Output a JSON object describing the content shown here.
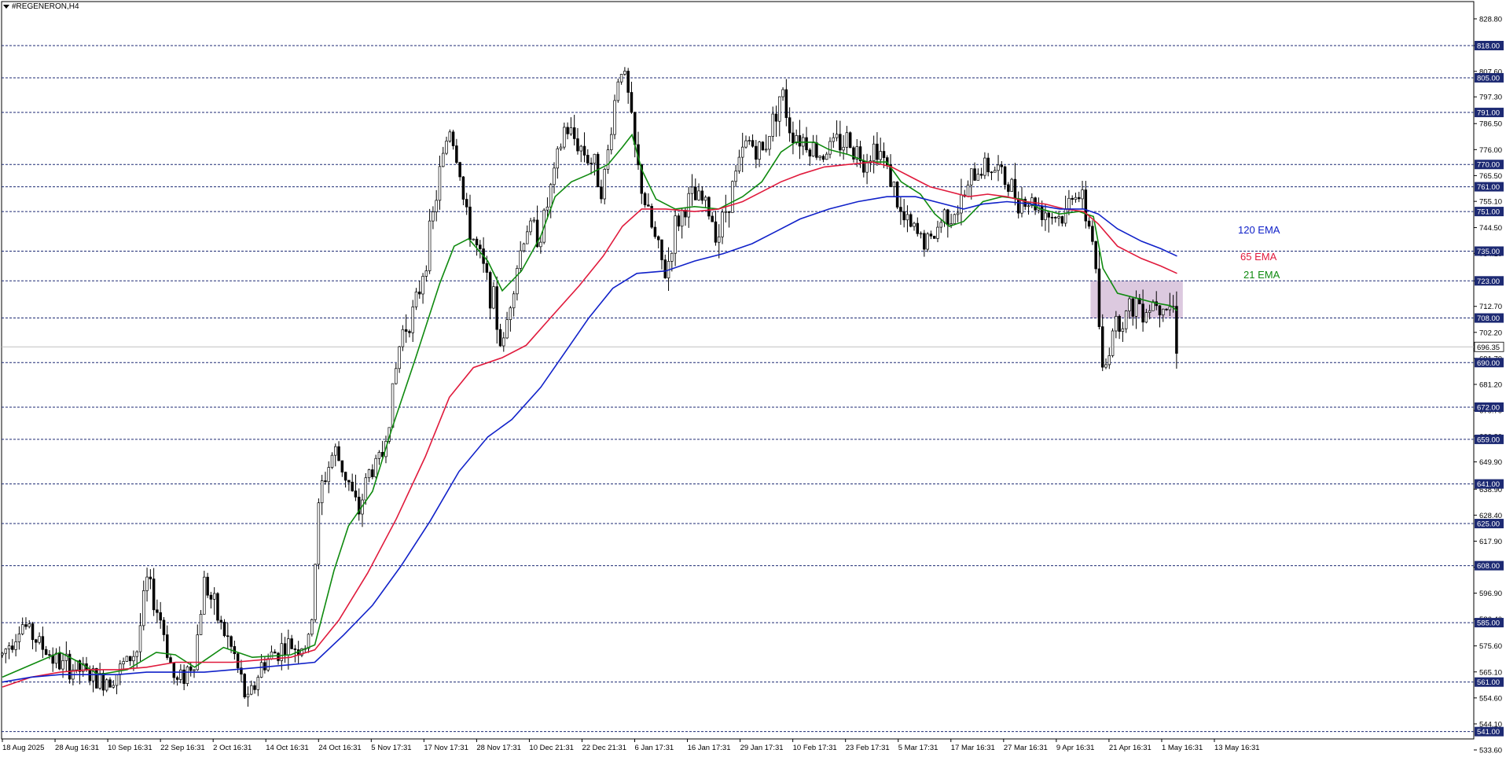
{
  "window": {
    "symbol_title": "#REGENERON,H4"
  },
  "chart_data": {
    "type": "candlestick",
    "symbol": "#REGENERON",
    "timeframe": "H4",
    "ylim": [
      533.6,
      832.6
    ],
    "price_ticks": [
      "828.80",
      "818.00",
      "807.60",
      "797.30",
      "786.50",
      "776.00",
      "765.50",
      "755.10",
      "744.50",
      "734.10",
      "723.00",
      "712.70",
      "702.20",
      "691.70",
      "681.20",
      "670.70",
      "660.30",
      "649.90",
      "638.90",
      "628.40",
      "617.90",
      "607.40",
      "596.90",
      "586.40",
      "575.60",
      "565.10",
      "554.60",
      "544.10",
      "533.60"
    ],
    "level_lines": [
      {
        "price": 818.0,
        "label": "818.00"
      },
      {
        "price": 805.0,
        "label": "805.00"
      },
      {
        "price": 791.0,
        "label": "791.00"
      },
      {
        "price": 770.0,
        "label": "770.00"
      },
      {
        "price": 761.0,
        "label": "761.00"
      },
      {
        "price": 751.0,
        "label": "751.00"
      },
      {
        "price": 735.0,
        "label": "735.00"
      },
      {
        "price": 723.0,
        "label": "723.00"
      },
      {
        "price": 708.0,
        "label": "708.00"
      },
      {
        "price": 690.0,
        "label": "690.00"
      },
      {
        "price": 672.0,
        "label": "672.00"
      },
      {
        "price": 659.0,
        "label": "659.00"
      },
      {
        "price": 641.0,
        "label": "641.00"
      },
      {
        "price": 625.0,
        "label": "625.00"
      },
      {
        "price": 608.0,
        "label": "608.00"
      },
      {
        "price": 585.0,
        "label": "585.00"
      },
      {
        "price": 561.0,
        "label": "561.00"
      },
      {
        "price": 541.0,
        "label": "541.00"
      }
    ],
    "current_price": {
      "price": 696.35,
      "label": "696.35"
    },
    "time_labels": [
      "18 Aug 2025",
      "28 Aug 16:31",
      "10 Sep 16:31",
      "22 Sep 16:31",
      "2 Oct 16:31",
      "14 Oct 16:31",
      "24 Oct 16:31",
      "5 Nov 17:31",
      "17 Nov 17:31",
      "28 Nov 17:31",
      "10 Dec 21:31",
      "22 Dec 21:31",
      "6 Jan 17:31",
      "16 Jan 17:31",
      "29 Jan 17:31",
      "10 Feb 17:31",
      "23 Feb 17:31",
      "5 Mar 17:31",
      "17 Mar 16:31",
      "27 Mar 16:31",
      "9 Apr 16:31",
      "21 Apr 16:31",
      "1 May 16:31",
      "13 May 16:31"
    ],
    "price_path": [
      [
        0,
        572
      ],
      [
        20,
        585
      ],
      [
        40,
        576
      ],
      [
        60,
        568
      ],
      [
        80,
        566
      ],
      [
        100,
        561
      ],
      [
        120,
        565
      ],
      [
        140,
        574
      ],
      [
        150,
        602
      ],
      [
        165,
        586
      ],
      [
        180,
        560
      ],
      [
        200,
        570
      ],
      [
        210,
        602
      ],
      [
        225,
        586
      ],
      [
        240,
        573
      ],
      [
        255,
        552
      ],
      [
        270,
        568
      ],
      [
        290,
        575
      ],
      [
        320,
        576
      ],
      [
        330,
        637
      ],
      [
        345,
        655
      ],
      [
        360,
        642
      ],
      [
        370,
        628
      ],
      [
        380,
        645
      ],
      [
        395,
        652
      ],
      [
        405,
        675
      ],
      [
        415,
        702
      ],
      [
        430,
        712
      ],
      [
        445,
        742
      ],
      [
        455,
        766
      ],
      [
        465,
        786
      ],
      [
        475,
        770
      ],
      [
        482,
        748
      ],
      [
        490,
        740
      ],
      [
        500,
        728
      ],
      [
        510,
        716
      ],
      [
        520,
        694
      ],
      [
        530,
        720
      ],
      [
        545,
        745
      ],
      [
        560,
        742
      ],
      [
        575,
        767
      ],
      [
        585,
        785
      ],
      [
        600,
        778
      ],
      [
        615,
        770
      ],
      [
        625,
        760
      ],
      [
        635,
        790
      ],
      [
        643,
        812
      ],
      [
        650,
        800
      ],
      [
        660,
        770
      ],
      [
        670,
        752
      ],
      [
        680,
        738
      ],
      [
        690,
        725
      ],
      [
        700,
        745
      ],
      [
        715,
        756
      ],
      [
        730,
        755
      ],
      [
        745,
        742
      ],
      [
        760,
        762
      ],
      [
        775,
        780
      ],
      [
        790,
        774
      ],
      [
        800,
        786
      ],
      [
        810,
        800
      ],
      [
        820,
        784
      ],
      [
        835,
        780
      ],
      [
        850,
        774
      ],
      [
        865,
        778
      ],
      [
        880,
        780
      ],
      [
        895,
        772
      ],
      [
        910,
        778
      ],
      [
        925,
        764
      ],
      [
        935,
        748
      ],
      [
        950,
        742
      ],
      [
        965,
        738
      ],
      [
        980,
        750
      ],
      [
        995,
        752
      ],
      [
        1010,
        765
      ],
      [
        1020,
        770
      ],
      [
        1035,
        768
      ],
      [
        1045,
        762
      ],
      [
        1060,
        756
      ],
      [
        1075,
        754
      ],
      [
        1090,
        750
      ],
      [
        1105,
        748
      ],
      [
        1115,
        762
      ],
      [
        1125,
        752
      ],
      [
        1135,
        740
      ],
      [
        1145,
        682
      ],
      [
        1155,
        705
      ],
      [
        1170,
        710
      ],
      [
        1180,
        715
      ],
      [
        1190,
        712
      ],
      [
        1200,
        716
      ],
      [
        1210,
        714
      ],
      [
        1218,
        712
      ],
      [
        1222,
        696
      ]
    ],
    "series": [
      {
        "name": "21 EMA",
        "color": "#0f8a0f",
        "points": [
          [
            0,
            563
          ],
          [
            30,
            568
          ],
          [
            60,
            573
          ],
          [
            80,
            569
          ],
          [
            100,
            564
          ],
          [
            130,
            566
          ],
          [
            160,
            573
          ],
          [
            180,
            572
          ],
          [
            200,
            567
          ],
          [
            230,
            575
          ],
          [
            260,
            571
          ],
          [
            300,
            572
          ],
          [
            325,
            576
          ],
          [
            345,
            606
          ],
          [
            360,
            624
          ],
          [
            385,
            638
          ],
          [
            405,
            663
          ],
          [
            430,
            692
          ],
          [
            455,
            722
          ],
          [
            470,
            737
          ],
          [
            485,
            740
          ],
          [
            505,
            731
          ],
          [
            520,
            719
          ],
          [
            540,
            727
          ],
          [
            560,
            741
          ],
          [
            575,
            757
          ],
          [
            592,
            763
          ],
          [
            610,
            766
          ],
          [
            630,
            770
          ],
          [
            645,
            777
          ],
          [
            655,
            782
          ],
          [
            665,
            768
          ],
          [
            680,
            756
          ],
          [
            700,
            752
          ],
          [
            720,
            753
          ],
          [
            745,
            752
          ],
          [
            770,
            757
          ],
          [
            790,
            763
          ],
          [
            810,
            775
          ],
          [
            825,
            779
          ],
          [
            845,
            779
          ],
          [
            860,
            776
          ],
          [
            880,
            774
          ],
          [
            900,
            771
          ],
          [
            920,
            771
          ],
          [
            935,
            763
          ],
          [
            955,
            758
          ],
          [
            970,
            750
          ],
          [
            985,
            745
          ],
          [
            1000,
            747
          ],
          [
            1020,
            755
          ],
          [
            1040,
            757
          ],
          [
            1060,
            756
          ],
          [
            1080,
            752
          ],
          [
            1100,
            750
          ],
          [
            1120,
            751
          ],
          [
            1135,
            749
          ],
          [
            1145,
            728
          ],
          [
            1160,
            718
          ],
          [
            1180,
            716
          ],
          [
            1200,
            714
          ],
          [
            1215,
            713
          ],
          [
            1222,
            711
          ]
        ]
      },
      {
        "name": "65 EMA",
        "color": "#e01a3c",
        "points": [
          [
            0,
            559
          ],
          [
            30,
            563
          ],
          [
            60,
            565
          ],
          [
            90,
            566
          ],
          [
            120,
            566
          ],
          [
            150,
            567
          ],
          [
            180,
            569
          ],
          [
            210,
            569
          ],
          [
            240,
            569
          ],
          [
            270,
            570
          ],
          [
            300,
            571
          ],
          [
            325,
            574
          ],
          [
            350,
            586
          ],
          [
            380,
            605
          ],
          [
            410,
            627
          ],
          [
            440,
            652
          ],
          [
            465,
            676
          ],
          [
            490,
            688
          ],
          [
            520,
            692
          ],
          [
            545,
            697
          ],
          [
            570,
            708
          ],
          [
            600,
            721
          ],
          [
            625,
            733
          ],
          [
            645,
            745
          ],
          [
            665,
            752
          ],
          [
            690,
            752
          ],
          [
            720,
            751
          ],
          [
            745,
            752
          ],
          [
            770,
            755
          ],
          [
            790,
            759
          ],
          [
            810,
            763
          ],
          [
            830,
            766
          ],
          [
            855,
            769
          ],
          [
            880,
            770
          ],
          [
            905,
            771
          ],
          [
            925,
            769
          ],
          [
            945,
            765
          ],
          [
            965,
            761
          ],
          [
            985,
            759
          ],
          [
            1005,
            757
          ],
          [
            1025,
            758
          ],
          [
            1045,
            757
          ],
          [
            1065,
            755
          ],
          [
            1085,
            754
          ],
          [
            1105,
            752
          ],
          [
            1125,
            751
          ],
          [
            1140,
            746
          ],
          [
            1160,
            737
          ],
          [
            1185,
            732
          ],
          [
            1205,
            729
          ],
          [
            1222,
            726
          ]
        ]
      },
      {
        "name": "120 EMA",
        "color": "#1021c9",
        "points": [
          [
            0,
            561
          ],
          [
            30,
            563
          ],
          [
            60,
            564
          ],
          [
            90,
            564
          ],
          [
            120,
            564
          ],
          [
            150,
            565
          ],
          [
            180,
            565
          ],
          [
            210,
            565
          ],
          [
            240,
            566
          ],
          [
            270,
            567
          ],
          [
            300,
            568
          ],
          [
            325,
            569
          ],
          [
            355,
            580
          ],
          [
            385,
            592
          ],
          [
            415,
            608
          ],
          [
            445,
            626
          ],
          [
            475,
            646
          ],
          [
            505,
            660
          ],
          [
            530,
            667
          ],
          [
            560,
            680
          ],
          [
            585,
            694
          ],
          [
            610,
            708
          ],
          [
            635,
            720
          ],
          [
            660,
            726
          ],
          [
            690,
            727
          ],
          [
            720,
            731
          ],
          [
            750,
            734
          ],
          [
            780,
            738
          ],
          [
            805,
            743
          ],
          [
            830,
            748
          ],
          [
            860,
            752
          ],
          [
            890,
            755
          ],
          [
            920,
            757
          ],
          [
            950,
            757
          ],
          [
            980,
            754
          ],
          [
            1000,
            752
          ],
          [
            1020,
            754
          ],
          [
            1045,
            755
          ],
          [
            1070,
            754
          ],
          [
            1100,
            752
          ],
          [
            1125,
            752
          ],
          [
            1140,
            750
          ],
          [
            1160,
            744
          ],
          [
            1185,
            739
          ],
          [
            1205,
            736
          ],
          [
            1222,
            733
          ]
        ]
      }
    ],
    "zone": {
      "x_start": 1132,
      "x_end": 1228,
      "price_top": 723,
      "price_bottom": 708,
      "color": "#d6bfd9"
    },
    "ema_labels": [
      {
        "text": "120 EMA",
        "color": "#1021c9"
      },
      {
        "text": "65 EMA",
        "color": "#e01a3c"
      },
      {
        "text": "21 EMA",
        "color": "#0f8a0f"
      }
    ],
    "grid": false,
    "colors": {
      "background": "#ffffff",
      "level_line": "#1d2a73",
      "label_bg": "#1d2a73",
      "label_text": "#ffffff",
      "current_line": "#c0c0c0",
      "candle": "#000000"
    }
  }
}
